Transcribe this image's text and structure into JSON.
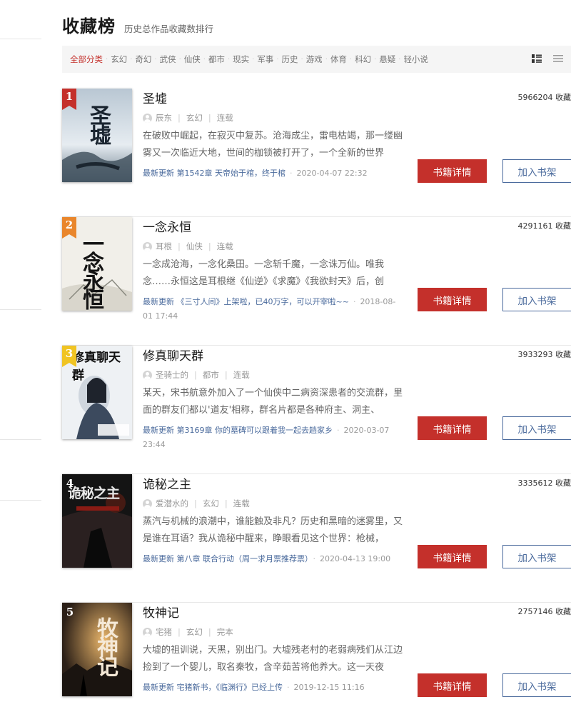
{
  "header": {
    "title": "收藏榜",
    "subtitle": "历史总作品收藏数排行"
  },
  "filters": [
    {
      "label": "全部分类",
      "active": true
    },
    {
      "label": "玄幻",
      "active": false
    },
    {
      "label": "奇幻",
      "active": false
    },
    {
      "label": "武侠",
      "active": false
    },
    {
      "label": "仙侠",
      "active": false
    },
    {
      "label": "都市",
      "active": false
    },
    {
      "label": "现实",
      "active": false
    },
    {
      "label": "军事",
      "active": false
    },
    {
      "label": "历史",
      "active": false
    },
    {
      "label": "游戏",
      "active": false
    },
    {
      "label": "体育",
      "active": false
    },
    {
      "label": "科幻",
      "active": false
    },
    {
      "label": "悬疑",
      "active": false
    },
    {
      "label": "轻小说",
      "active": false
    }
  ],
  "view_icons": [
    "list-detail-icon",
    "list-compact-icon"
  ],
  "buttons": {
    "detail": "书籍详情",
    "shelf": "加入书架"
  },
  "update_label": "最新更新",
  "colors": {
    "accent": "#c4302b",
    "link": "#4a6a9c",
    "rank2": "#e9862c",
    "rank3": "#f0c423"
  },
  "books": [
    {
      "rank": "1",
      "name": "圣墟",
      "author": "辰东",
      "genre": "玄幻",
      "status": "连载",
      "intro": "在破败中崛起，在寂灭中复苏。沧海成尘，雷电枯竭，那一缕幽雾又一次临近大地，世间的枷锁被打开了，一个全新的世界",
      "latest": "第1542章 天帝始于棺，终于棺",
      "time": "2020-04-07 22:32",
      "count": "5966204 收藏",
      "cover_text": "圣墟"
    },
    {
      "rank": "2",
      "name": "一念永恒",
      "author": "耳根",
      "genre": "仙侠",
      "status": "连载",
      "intro": "一念成沧海，一念化桑田。一念斩千魔，一念诛万仙。唯我念……永恒这是耳根继《仙逆》《求魔》《我欲封天》后，创",
      "latest": "《三寸人间》上架啦，已40万字，可以开宰啦~~",
      "time": "2018-08-01 17:44",
      "count": "4291161 收藏",
      "cover_text": "一念永恒"
    },
    {
      "rank": "3",
      "name": "修真聊天群",
      "author": "圣骑士的",
      "genre": "都市",
      "status": "连载",
      "intro": "某天，宋书航意外加入了一个仙侠中二病资深患者的交流群，里面的群友们都以'道友'相称，群名片都是各种府主、洞主、",
      "latest": "第3169章 你的墓碑可以跟着我一起去趟家乡",
      "time": "2020-03-07 23:44",
      "count": "3933293 收藏",
      "cover_text": "修真聊天群"
    },
    {
      "rank": "4",
      "name": "诡秘之主",
      "author": "爱潜水的",
      "genre": "玄幻",
      "status": "连载",
      "intro": "蒸汽与机械的浪潮中，谁能触及非凡？历史和黑暗的迷雾里，又是谁在耳语？我从诡秘中醒来，睁眼看见这个世界：枪械，",
      "latest": "第八章 联合行动（周一求月票推荐票）",
      "time": "2020-04-13 19:00",
      "count": "3335612 收藏",
      "cover_text": "诡秘之主"
    },
    {
      "rank": "5",
      "name": "牧神记",
      "author": "宅猪",
      "genre": "玄幻",
      "status": "完本",
      "intro": "大墟的祖训说，天黑，别出门。大墟残老村的老弱病残们从江边捡到了一个婴儿，取名秦牧，含辛茹苦将他养大。这一天夜",
      "latest": "宅猪新书，《临渊行》已经上传",
      "time": "2019-12-15 11:16",
      "count": "2757146 收藏",
      "cover_text": "牧神记"
    }
  ]
}
